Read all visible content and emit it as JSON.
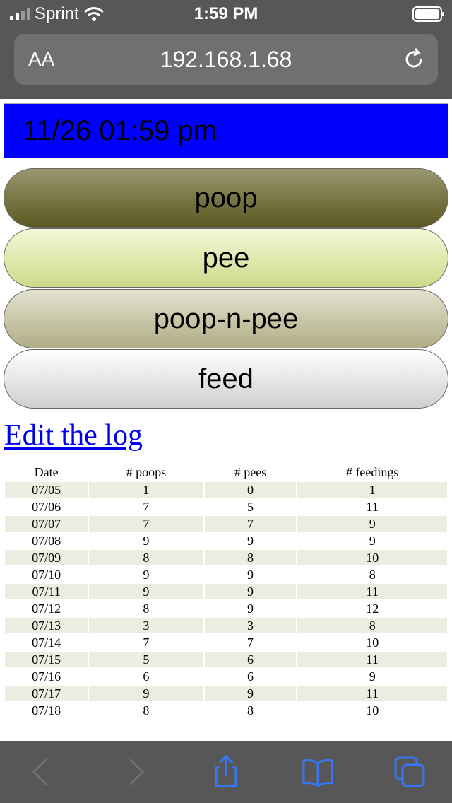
{
  "status_bar": {
    "carrier": "Sprint",
    "time": "1:59 PM"
  },
  "url_bar": {
    "text_size_label": "AA",
    "url": "192.168.1.68"
  },
  "page": {
    "datetime": "11/26 01:59 pm",
    "buttons": [
      "poop",
      "pee",
      "poop-n-pee",
      "feed"
    ],
    "edit_link": "Edit the log"
  },
  "log_table": {
    "headers": [
      "Date",
      "# poops",
      "# pees",
      "# feedings"
    ],
    "rows": [
      [
        "07/05",
        "1",
        "0",
        "1"
      ],
      [
        "07/06",
        "7",
        "5",
        "11"
      ],
      [
        "07/07",
        "7",
        "7",
        "9"
      ],
      [
        "07/08",
        "9",
        "9",
        "9"
      ],
      [
        "07/09",
        "8",
        "8",
        "10"
      ],
      [
        "07/10",
        "9",
        "9",
        "8"
      ],
      [
        "07/11",
        "9",
        "9",
        "11"
      ],
      [
        "07/12",
        "8",
        "9",
        "12"
      ],
      [
        "07/13",
        "3",
        "3",
        "8"
      ],
      [
        "07/14",
        "7",
        "7",
        "10"
      ],
      [
        "07/15",
        "5",
        "6",
        "11"
      ],
      [
        "07/16",
        "6",
        "6",
        "9"
      ],
      [
        "07/17",
        "9",
        "9",
        "11"
      ],
      [
        "07/18",
        "8",
        "8",
        "10"
      ]
    ]
  },
  "toolbar": {
    "icons": [
      "back-icon",
      "forward-icon",
      "share-icon",
      "bookmarks-icon",
      "tabs-icon"
    ]
  },
  "colors": {
    "chrome": "#575757",
    "datetime_bg": "#0000ff",
    "link": "#0000ee",
    "toolbar_accent": "#3478f6"
  }
}
